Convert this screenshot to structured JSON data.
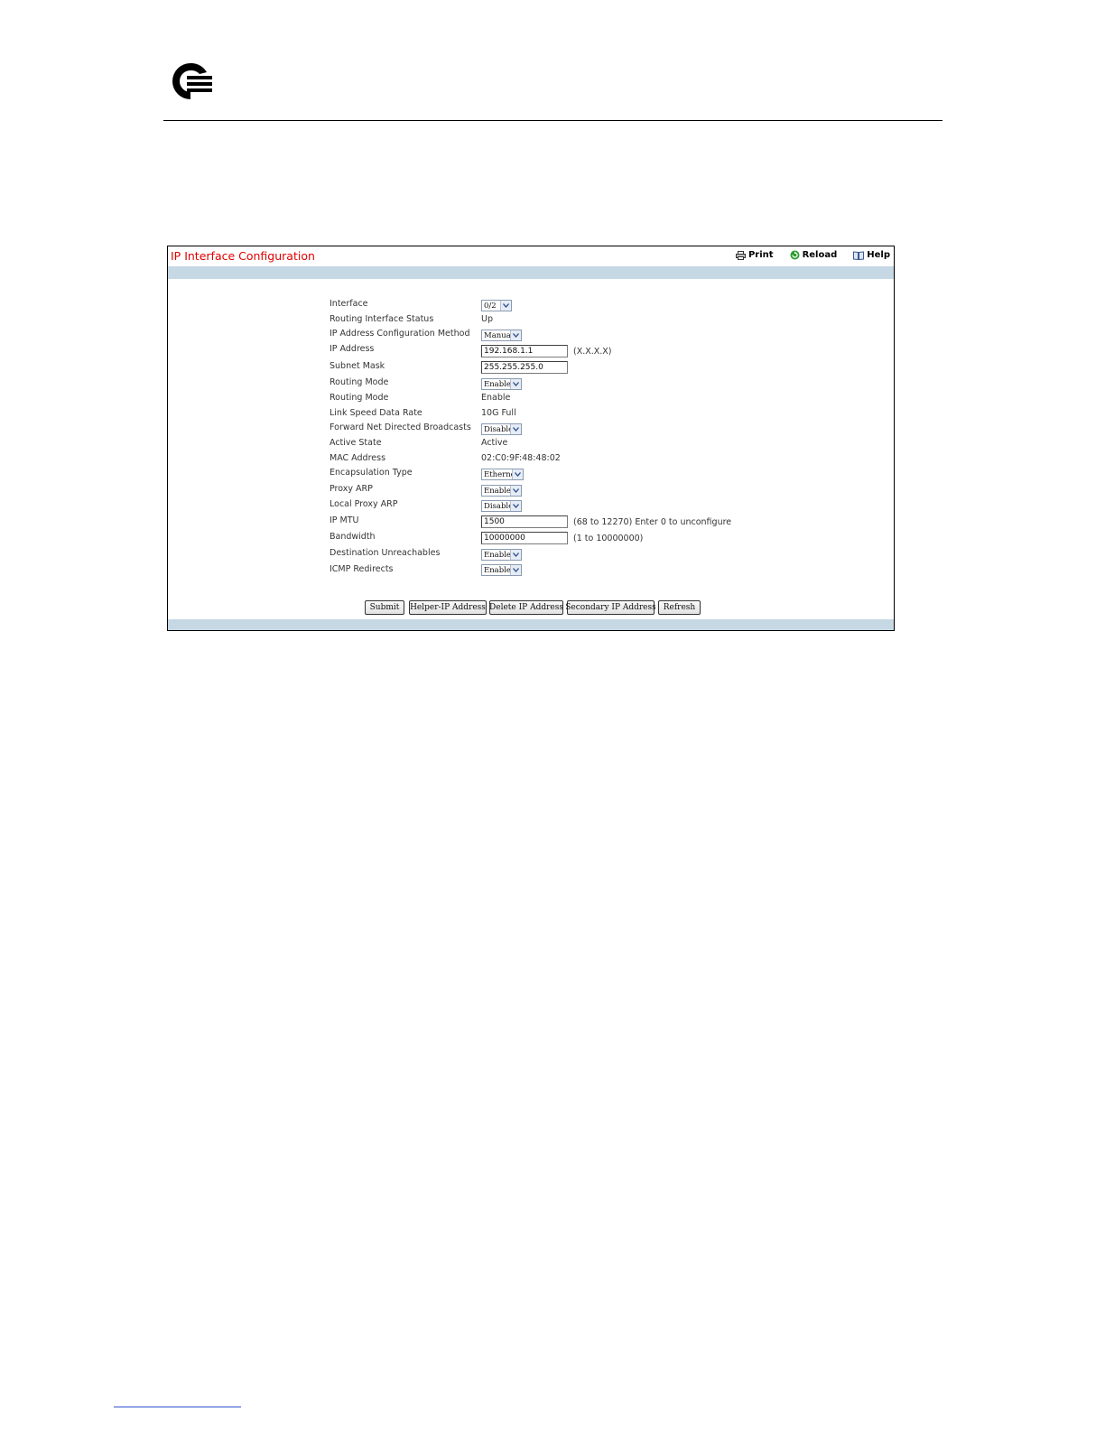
{
  "page": {
    "title": "IP Interface Configuration",
    "toolbar": {
      "print": "Print",
      "reload": "Reload",
      "help": "Help"
    }
  },
  "form": {
    "interface": {
      "label": "Interface",
      "value": "0/2"
    },
    "routing_interface_status": {
      "label": "Routing Interface Status",
      "value": "Up"
    },
    "ip_config_method": {
      "label": "IP Address Configuration Method",
      "value": "Manual"
    },
    "ip_address": {
      "label": "IP Address",
      "value": "192.168.1.1",
      "hint": "(X.X.X.X)"
    },
    "subnet_mask": {
      "label": "Subnet Mask",
      "value": "255.255.255.0"
    },
    "routing_mode_select": {
      "label": "Routing Mode",
      "value": "Enable"
    },
    "routing_mode_status": {
      "label": "Routing Mode",
      "value": "Enable"
    },
    "link_speed": {
      "label": "Link Speed Data Rate",
      "value": "10G Full"
    },
    "fwd_net_directed": {
      "label": "Forward Net Directed Broadcasts",
      "value": "Disable"
    },
    "active_state": {
      "label": "Active State",
      "value": "Active"
    },
    "mac_address": {
      "label": "MAC Address",
      "value": "02:C0:9F:48:48:02"
    },
    "encapsulation": {
      "label": "Encapsulation Type",
      "value": "Ethernet"
    },
    "proxy_arp": {
      "label": "Proxy ARP",
      "value": "Enable"
    },
    "local_proxy_arp": {
      "label": "Local Proxy ARP",
      "value": "Disable"
    },
    "ip_mtu": {
      "label": "IP MTU",
      "value": "1500",
      "hint": "(68 to 12270) Enter 0 to unconfigure"
    },
    "bandwidth": {
      "label": "Bandwidth",
      "value": "10000000",
      "hint": "(1 to 10000000)"
    },
    "dest_unreachables": {
      "label": "Destination Unreachables",
      "value": "Enable"
    },
    "icmp_redirects": {
      "label": "ICMP Redirects",
      "value": "Enable"
    }
  },
  "buttons": {
    "submit": "Submit",
    "helper_ip": "Helper-IP Address",
    "delete_ip": "Delete IP Address",
    "secondary_ip": "Secondary IP Address",
    "refresh": "Refresh"
  },
  "colors": {
    "title": "#e00000",
    "band": "#c6d8e4"
  }
}
